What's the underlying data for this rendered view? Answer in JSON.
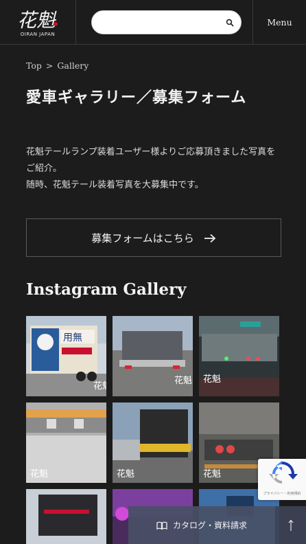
{
  "header": {
    "logo_text": "花魁",
    "logo_sub": "OIRAN JAPAN",
    "search_placeholder": "",
    "menu_label": "Menu"
  },
  "breadcrumb": {
    "items": [
      "Top",
      "Gallery"
    ],
    "separator": ">"
  },
  "page": {
    "title": "愛車ギャラリー／募集フォーム",
    "intro_line1": "花魁テールランプ装着ユーザー様よりご応募頂きました写真をご紹介。",
    "intro_line2": "随時、花魁テール装着写真を大募集中です。",
    "form_button_label": "募集フォームはこちら"
  },
  "gallery": {
    "title": "Instagram Gallery",
    "items": [
      {
        "label": "photo-1",
        "watermark": "花魁"
      },
      {
        "label": "photo-2",
        "watermark": "花魁"
      },
      {
        "label": "photo-3",
        "watermark": "花魁"
      },
      {
        "label": "photo-4",
        "watermark": "花魁"
      },
      {
        "label": "photo-5",
        "watermark": "花魁"
      },
      {
        "label": "photo-6",
        "watermark": "花魁"
      },
      {
        "label": "photo-7",
        "watermark": ""
      },
      {
        "label": "photo-8",
        "watermark": ""
      },
      {
        "label": "photo-9",
        "watermark": ""
      }
    ]
  },
  "recaptcha": {
    "label": "プライバシー・利用規約"
  },
  "footer_bar": {
    "catalog_label": "カタログ・資料請求",
    "top_icon": "up-arrow-icon"
  },
  "colors": {
    "background": "#1c1c1c",
    "border": "#3a3a3a",
    "catalog_bar": "#485066",
    "accent_red": "#c8102e"
  }
}
